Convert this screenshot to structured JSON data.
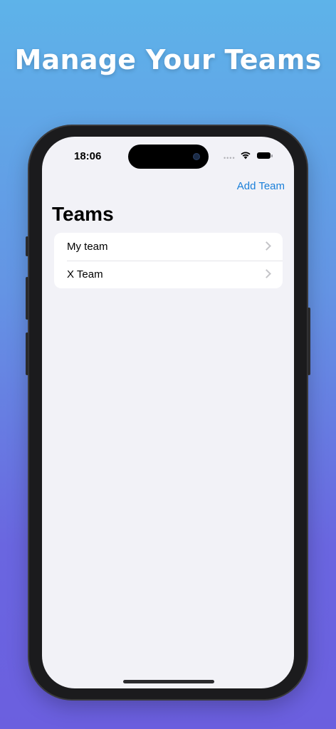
{
  "headline": "Manage Your Teams",
  "status_bar": {
    "time": "18:06",
    "signal_dots": "••••",
    "wifi_icon": "wifi-icon",
    "battery_icon": "battery-icon"
  },
  "nav": {
    "add_team_label": "Add Team"
  },
  "page": {
    "title": "Teams"
  },
  "teams": [
    {
      "name": "My team"
    },
    {
      "name": "X Team"
    }
  ],
  "colors": {
    "accent": "#1a7fd9",
    "background_top": "#5eb3e9",
    "background_bottom": "#6b5fdf",
    "screen_background": "#f2f2f7"
  }
}
